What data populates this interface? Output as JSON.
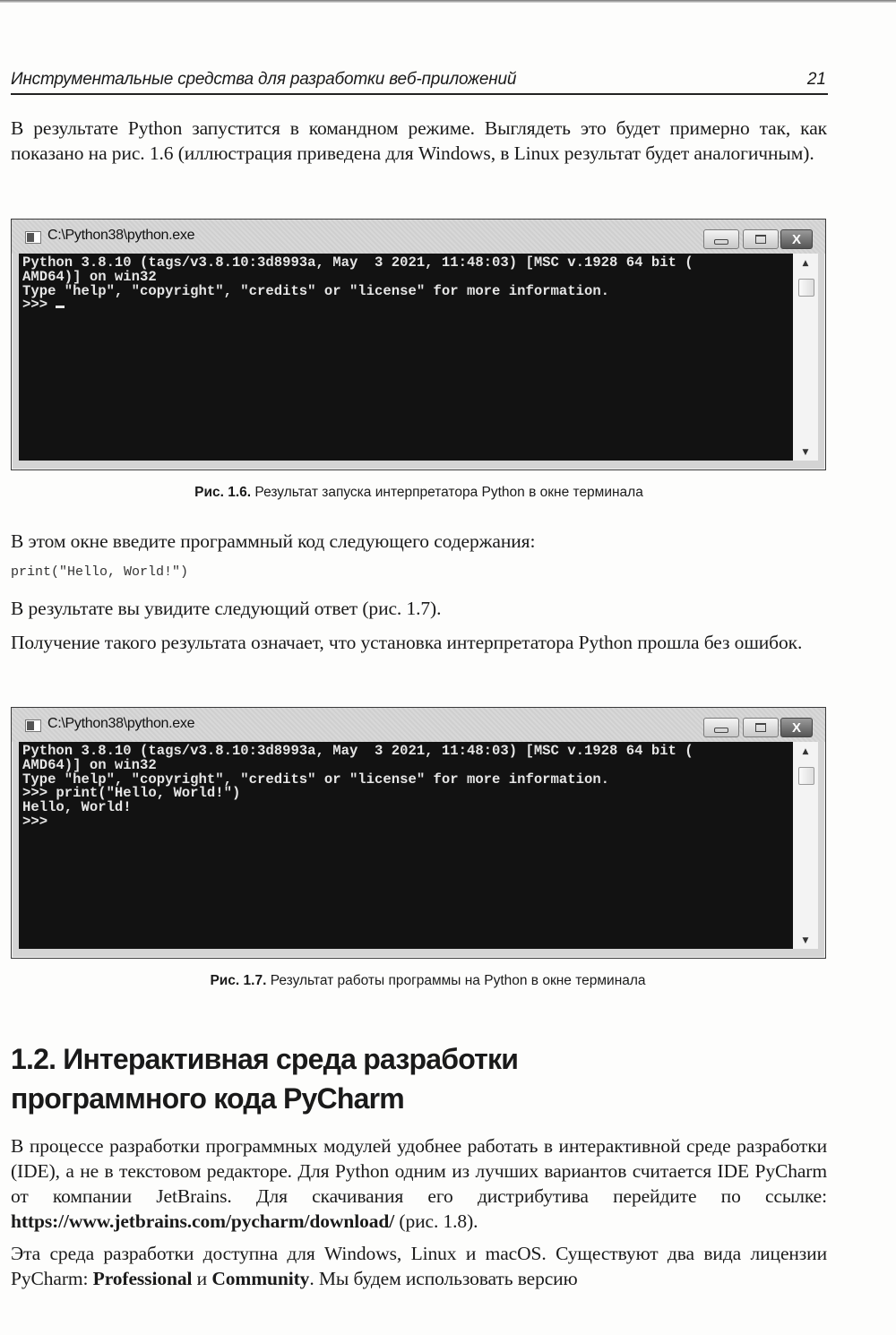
{
  "header": {
    "running_title": "Инструментальные средства для разработки веб-приложений",
    "page_number": "21"
  },
  "paragraphs": {
    "p1": "В результате Python запустится в командном режиме. Выглядеть это будет примерно так, как показано на рис. 1.6 (иллюстрация приведена для Windows, в Linux результат будет аналогичным).",
    "p2": "В этом окне введите программный код следующего содержания:",
    "code": "print(\"Hello, World!\")",
    "p3": "В результате вы увидите следующий ответ (рис. 1.7).",
    "p4": "Получение такого результата означает, что установка интерпретатора Python прошла без ошибок.",
    "p5_before_link": "В процессе разработки программных модулей удобнее работать в интерактивной среде разработки (IDE), а не в текстовом редакторе. Для Python одним из лучших вариантов считается IDE PyCharm от компании JetBrains. Для скачивания его дистрибутива перейдите по ссылке: ",
    "p5_link": "https://www.jetbrains.com/pycharm/download/",
    "p5_after_link": " (рис. 1.8).",
    "p6_part1": "Эта среда разработки доступна для Windows, Linux и macOS. Существуют два вида лицензии PyCharm: ",
    "p6_bold1": "Professional",
    "p6_part2": " и ",
    "p6_bold2": "Community",
    "p6_part3": ". Мы будем использовать версию"
  },
  "figures": {
    "fig1": {
      "window_title": "C:\\Python38\\python.exe",
      "console_lines": [
        "Python 3.8.10 (tags/v3.8.10:3d8993a, May  3 2021, 11:48:03) [MSC v.1928 64 bit (",
        "AMD64)] on win32",
        "Type \"help\", \"copyright\", \"credits\" or \"license\" for more information.",
        ">>> "
      ],
      "caption_label": "Рис. 1.6.",
      "caption_text": " Результат запуска интерпретатора Python в окне терминала"
    },
    "fig2": {
      "window_title": "C:\\Python38\\python.exe",
      "console_lines": [
        "Python 3.8.10 (tags/v3.8.10:3d8993a, May  3 2021, 11:48:03) [MSC v.1928 64 bit (",
        "AMD64)] on win32",
        "Type \"help\", \"copyright\", \"credits\" or \"license\" for more information.",
        ">>> print(\"Hello, World!\")",
        "Hello, World!",
        ">>>"
      ],
      "caption_label": "Рис. 1.7.",
      "caption_text": " Результат работы программы на Python в окне терминала"
    }
  },
  "window_controls": {
    "minimize_icon": "minimize-icon",
    "maximize_icon": "maximize-icon",
    "close_icon": "close-icon",
    "close_glyph": "X",
    "scroll_up_glyph": "▲",
    "scroll_down_glyph": "▼"
  },
  "section": {
    "title_line1": "1.2. Интерактивная среда разработки",
    "title_line2": "программного кода PyCharm"
  }
}
